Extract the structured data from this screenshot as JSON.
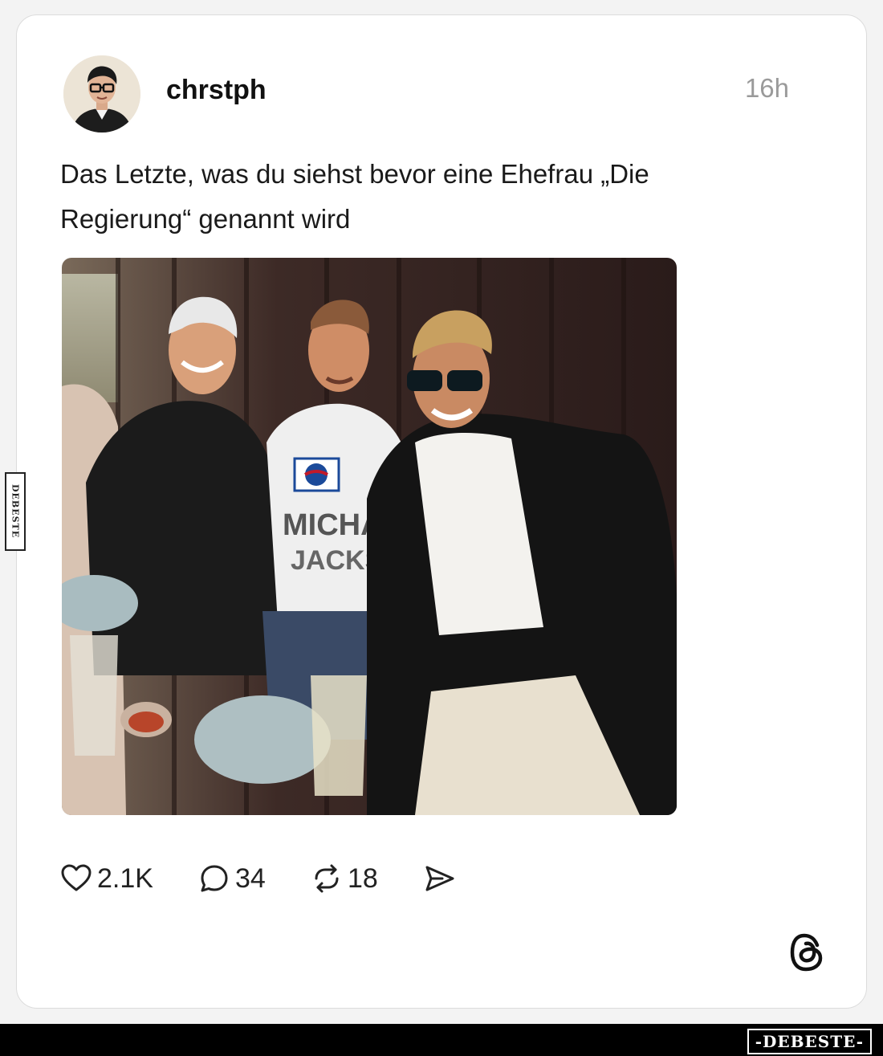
{
  "post": {
    "username": "chrstph",
    "timestamp": "16h",
    "text": "Das Letzte, was du siehst bevor eine Ehefrau „Die Regierung“ genannt wird",
    "photo": {
      "shirt_text_brand": "PEPSI",
      "shirt_text_main": "MICHAEL",
      "shirt_text_second": "JACKSON"
    }
  },
  "actions": {
    "likes": "2.1K",
    "comments": "34",
    "reposts": "18"
  },
  "icons": [
    "heart-icon",
    "comment-icon",
    "repost-icon",
    "share-icon",
    "threads-logo-icon"
  ],
  "watermark": {
    "side": "DEBESTE",
    "bottom": "-DEBESTE-"
  },
  "colors": {
    "card_bg": "#ffffff",
    "page_bg": "#f3f3f3",
    "text": "#1a1a1a",
    "muted": "#9a9a9a",
    "bar": "#000000"
  }
}
